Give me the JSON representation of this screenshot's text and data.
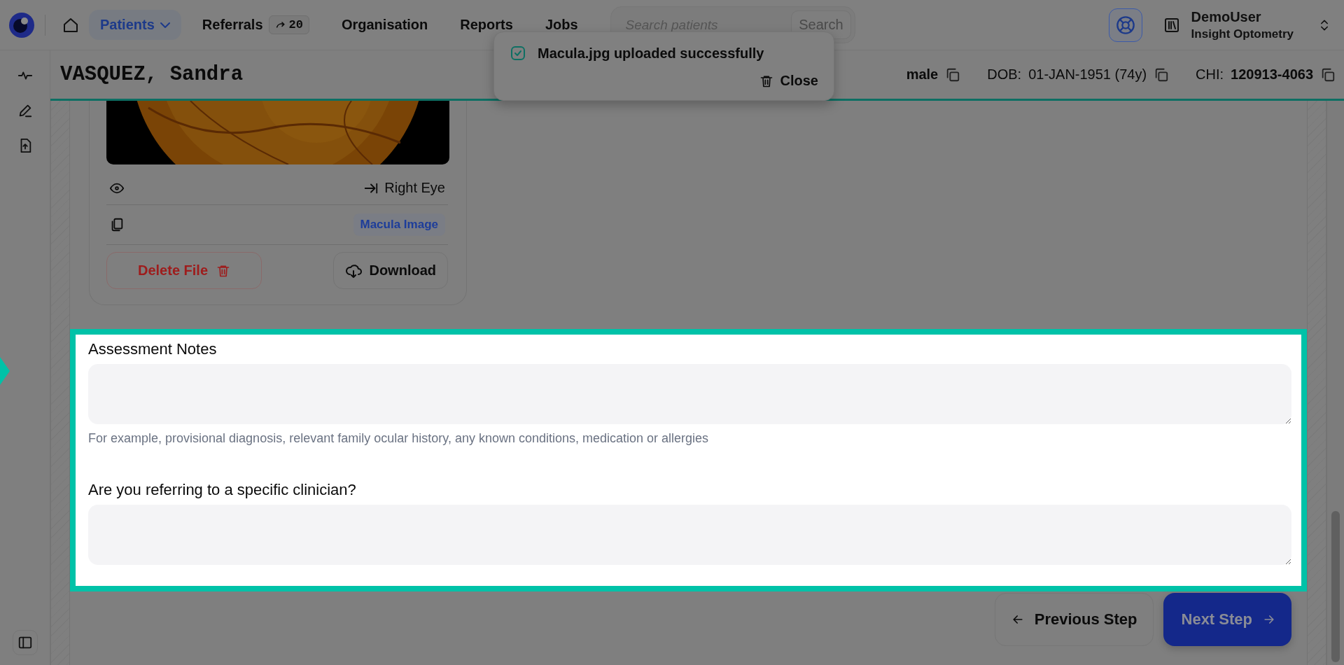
{
  "nav": {
    "items": [
      {
        "label": "Patients",
        "selected": true,
        "kind": "dropdown"
      },
      {
        "label": "Referrals",
        "selected": false,
        "kind": "badge",
        "badge": "20"
      },
      {
        "label": "Organisation",
        "selected": false,
        "kind": "link"
      },
      {
        "label": "Reports",
        "selected": false,
        "kind": "link"
      },
      {
        "label": "Jobs",
        "selected": false,
        "kind": "link"
      }
    ]
  },
  "search": {
    "placeholder": "Search patients",
    "button": "Search"
  },
  "user": {
    "name": "DemoUser",
    "org": "Insight Optometry"
  },
  "patient": {
    "name": "VASQUEZ, Sandra",
    "gender": "male",
    "dob_label": "DOB:",
    "dob": "01-JAN-1951 (74y)",
    "chi_label": "CHI:",
    "chi": "120913-4063"
  },
  "file_card": {
    "eye": "Right Eye",
    "tag": "Macula Image",
    "delete": "Delete File",
    "download": "Download"
  },
  "form": {
    "fields": [
      {
        "label": "Assessment Notes",
        "hint": "For example, provisional diagnosis, relevant family ocular history, any known conditions, medication or allergies"
      },
      {
        "label": "Are you referring to a specific clinician?"
      }
    ]
  },
  "footer": {
    "previous": "Previous Step",
    "next": "Next Step"
  },
  "toast": {
    "message": "Macula.jpg uploaded successfully",
    "close": "Close"
  }
}
